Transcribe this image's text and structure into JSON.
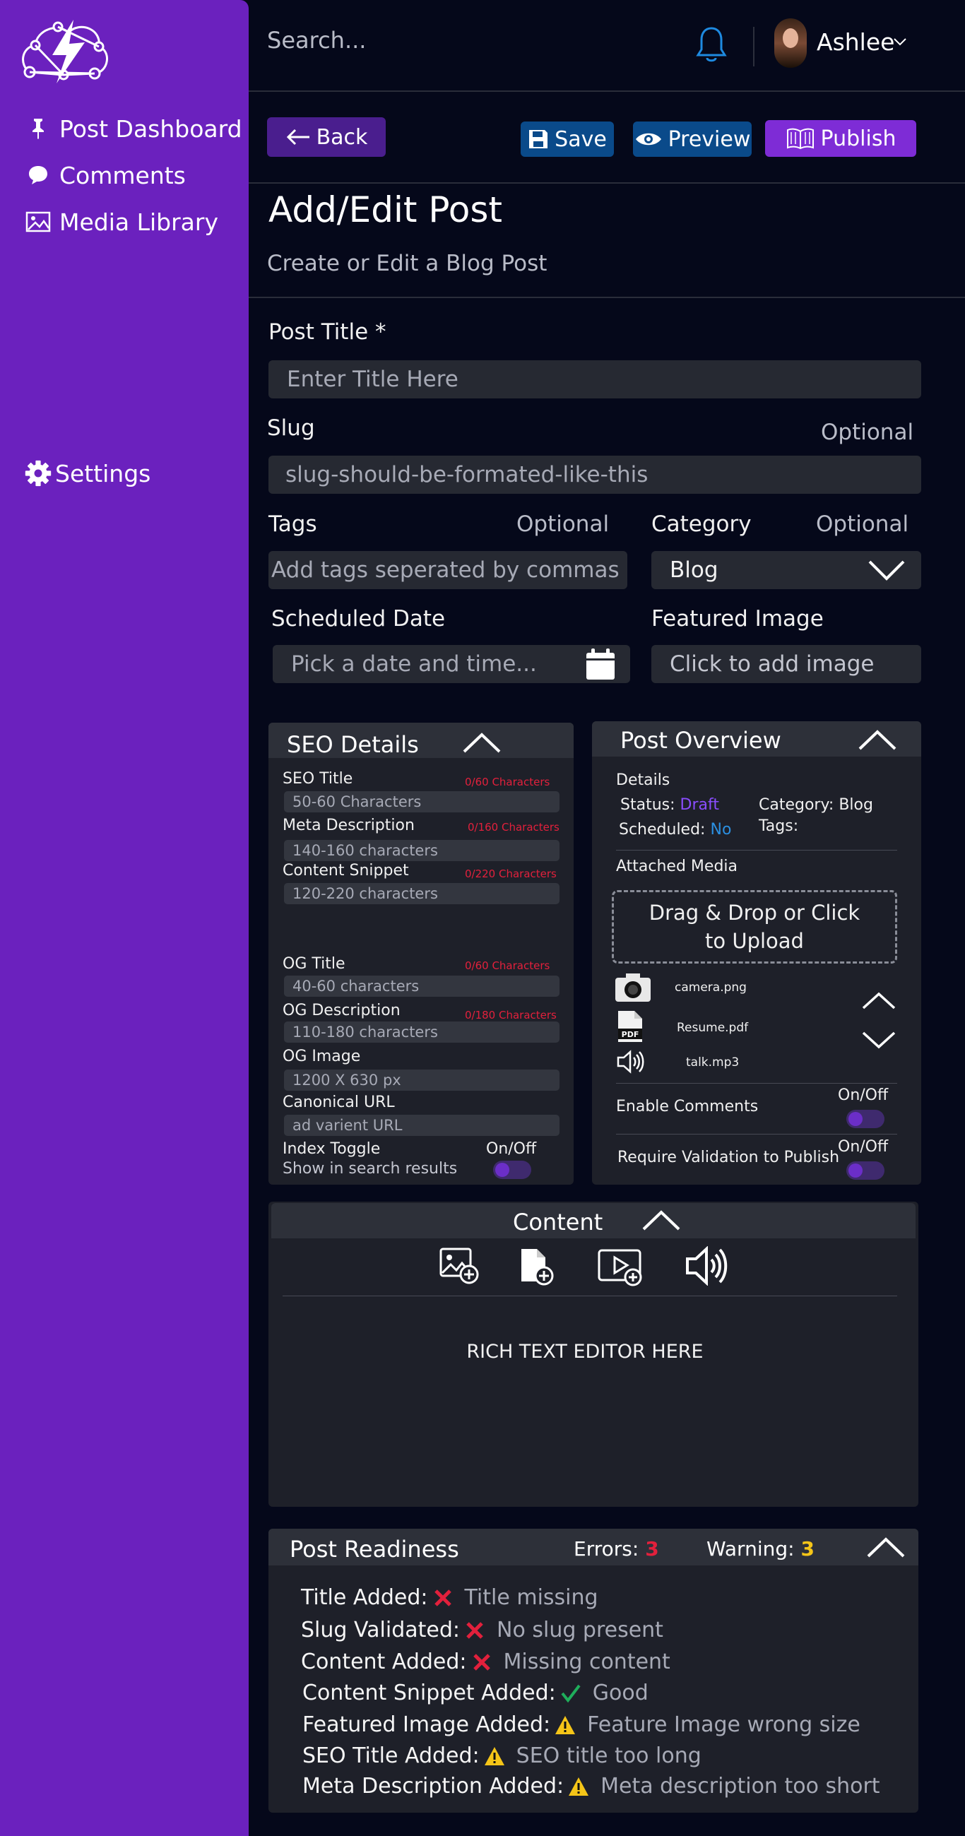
{
  "sidebar": {
    "items": [
      {
        "label": "Post Dashboard",
        "icon": "pin-icon"
      },
      {
        "label": "Comments",
        "icon": "comment-icon"
      },
      {
        "label": "Media Library",
        "icon": "image-icon"
      }
    ],
    "settings_label": "Settings"
  },
  "topbar": {
    "search_placeholder": "Search...",
    "username": "Ashlee"
  },
  "actions": {
    "back": "Back",
    "save": "Save",
    "preview": "Preview",
    "publish": "Publish"
  },
  "page": {
    "title": "Add/Edit Post",
    "subtitle": "Create or Edit a Blog Post"
  },
  "form": {
    "post_title_label": "Post Title *",
    "post_title_placeholder": "Enter Title Here",
    "slug_label": "Slug",
    "slug_optional": "Optional",
    "slug_placeholder": "slug-should-be-formated-like-this",
    "tags_label": "Tags",
    "tags_optional": "Optional",
    "tags_placeholder": "Add tags seperated by commas",
    "category_label": "Category",
    "category_optional": "Optional",
    "category_value": "Blog",
    "scheduled_label": "Scheduled Date",
    "scheduled_placeholder": "Pick a date and time...",
    "featured_label": "Featured Image",
    "featured_placeholder": "Click to add image"
  },
  "seo": {
    "title": "SEO Details",
    "fields": [
      {
        "label": "SEO Title",
        "count": "0/60 Characters",
        "placeholder": "50-60 Characters"
      },
      {
        "label": "Meta Description",
        "count": "0/160 Characters",
        "placeholder": "140-160 characters"
      },
      {
        "label": "Content Snippet",
        "count": "0/220 Characters",
        "placeholder": "120-220 characters"
      },
      {
        "label": "OG Title",
        "count": "0/60 Characters",
        "placeholder": "40-60 characters"
      },
      {
        "label": "OG Description",
        "count": "0/180 Characters",
        "placeholder": "110-180 characters"
      },
      {
        "label": "OG Image",
        "placeholder": "1200 X 630 px"
      },
      {
        "label": "Canonical URL",
        "placeholder": "ad varient URL"
      }
    ],
    "index_toggle_label": "Index Toggle",
    "index_toggle_sub": "Show in search results",
    "index_toggle_state": "On/Off"
  },
  "overview": {
    "title": "Post Overview",
    "details_label": "Details",
    "status_label": "Status:",
    "status_value": "Draft",
    "scheduled_label": "Scheduled:",
    "scheduled_value": "No",
    "category_label": "Category:",
    "category_value": "Blog",
    "tags_label": "Tags:",
    "attached_label": "Attached Media",
    "dropzone": [
      "Drag & Drop or Click",
      "to Upload"
    ],
    "files": [
      "camera.png",
      "Resume.pdf",
      "talk.mp3"
    ],
    "enable_comments": "Enable Comments",
    "enable_comments_state": "On/Off",
    "require_validation": "Require Validation to Publish",
    "require_validation_state": "On/Off"
  },
  "content": {
    "title": "Content",
    "editor_text": "RICH TEXT EDITOR HERE"
  },
  "readiness": {
    "title": "Post Readiness",
    "errors_label": "Errors:",
    "errors_count": "3",
    "warning_label": "Warning:",
    "warning_count": "3",
    "items": [
      {
        "key": "Title Added:",
        "status": "error",
        "msg": "Title missing"
      },
      {
        "key": "Slug Validated:",
        "status": "error",
        "msg": "No slug present"
      },
      {
        "key": "Content Added:",
        "status": "error",
        "msg": "Missing content"
      },
      {
        "key": "Content Snippet Added:",
        "status": "ok",
        "msg": "Good"
      },
      {
        "key": "Featured Image Added:",
        "status": "warning",
        "msg": "Feature Image wrong size"
      },
      {
        "key": "SEO Title Added:",
        "status": "warning",
        "msg": "SEO title too long"
      },
      {
        "key": "Meta Description Added:",
        "status": "warning",
        "msg": "Meta description too short"
      }
    ]
  },
  "colors": {
    "sidebar": "#6b21be",
    "background": "#05081a",
    "accent_blue": "#0a4a8a",
    "publish": "#7e2cd6",
    "error": "#e2203c",
    "warning": "#f5c518",
    "ok": "#1fae5b",
    "draft": "#8a4dff",
    "link_blue": "#2b8fe0"
  }
}
